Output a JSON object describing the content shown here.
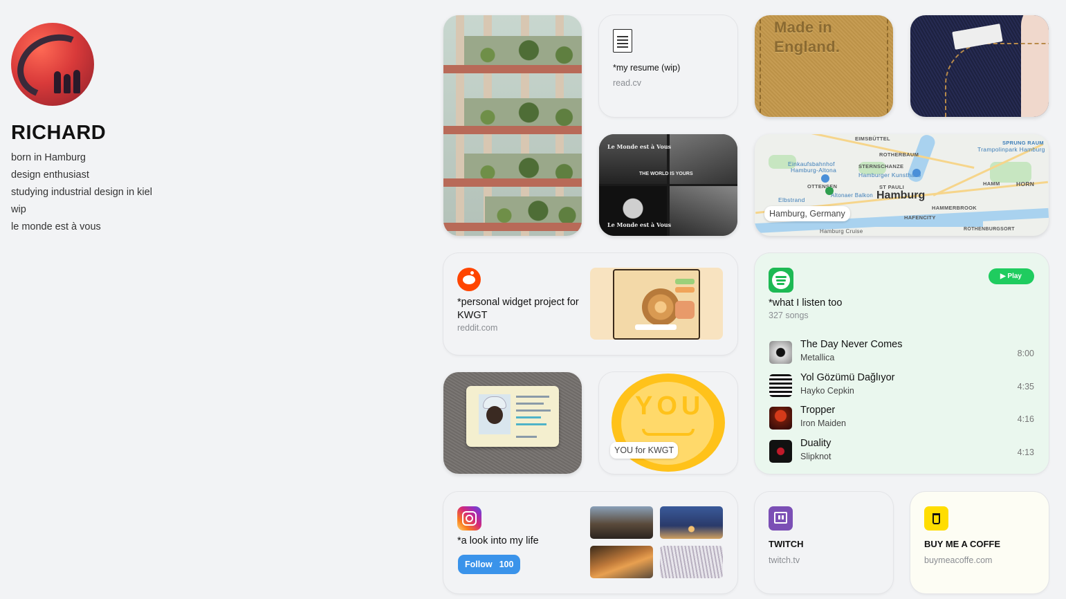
{
  "profile": {
    "name": "RICHARD",
    "bio": [
      "born in Hamburg",
      "design enthusiast",
      "studying industrial design in kiel",
      "wip",
      "le monde est à vous"
    ]
  },
  "resume": {
    "title": "*my resume (wip)",
    "source": "read.cv",
    "icon": "document-icon"
  },
  "england": {
    "text_line1": "Made in",
    "text_line2": "England."
  },
  "monde": {
    "caption_top": "Le Monde est à Vous",
    "caption_mid": "THE WORLD IS YOURS",
    "caption_bottom": "Le Monde est à Vous"
  },
  "map": {
    "city": "Hamburg",
    "location_label": "Hamburg, Germany",
    "labels": [
      "EIMSBÜTTEL",
      "SPRUNG RAUM",
      "Trampolinpark Hamburg",
      "ROTHERBAUM",
      "Einkaufsbahnhof",
      "Hamburg-Altona",
      "STERNSCHANZE",
      "Hamburger Kunsthalle",
      "OTTENSEN",
      "ST PAULI",
      "HAMM",
      "HORN",
      "Elbstrand",
      "Altonaer Balkon",
      "HAMMERBROOK",
      "HAFENCITY",
      "ROTHENBURGSORT",
      "Hamburg Cruise"
    ]
  },
  "reddit": {
    "title": "*personal widget project for KWGT",
    "source": "reddit.com",
    "icon": "reddit-icon"
  },
  "you": {
    "big_text": "YOU",
    "label": "YOU for KWGT"
  },
  "spotify": {
    "icon": "spotify-icon",
    "play_label": "▶ Play",
    "title": "*what I listen too",
    "count": "327 songs",
    "tracks": [
      {
        "title": "The Day Never Comes",
        "artist": "Metallica",
        "duration": "8:00"
      },
      {
        "title": "Yol Gözümü Dağlıyor",
        "artist": "Hayko Cepkin",
        "duration": "4:35"
      },
      {
        "title": "Tropper",
        "artist": "Iron Maiden",
        "duration": "4:16"
      },
      {
        "title": "Duality",
        "artist": "Slipknot",
        "duration": "4:13"
      }
    ]
  },
  "instagram": {
    "icon": "instagram-icon",
    "title": "*a look into my life",
    "follow_label": "Follow",
    "follow_count": "100"
  },
  "twitch": {
    "icon": "twitch-icon",
    "title": "TWITCH",
    "source": "twitch.tv"
  },
  "coffee": {
    "icon": "coffee-cup-icon",
    "title": "BUY ME A COFFE",
    "source": "buymeacoffe.com"
  },
  "colors": {
    "spotify_green": "#1db954",
    "follow_blue": "#3a93ea",
    "twitch_purple": "#7b4fb5",
    "bmc_yellow": "#ffdd00",
    "reddit_orange": "#ff4500"
  }
}
